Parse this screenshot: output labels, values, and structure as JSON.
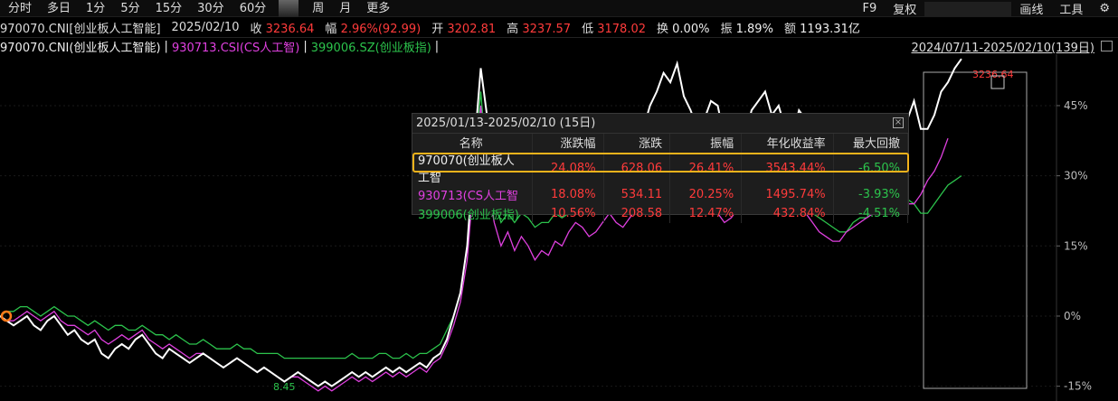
{
  "toolbar": {
    "timeframes": [
      "分时",
      "多日",
      "1分",
      "5分",
      "15分",
      "30分",
      "60分",
      "周",
      "月",
      "更多"
    ],
    "right": [
      "F9",
      "复权",
      "画线",
      "工具"
    ]
  },
  "quote": {
    "code": "970070.CNI[创业板人工智能]",
    "date": "2025/02/10",
    "close_label": "收",
    "close": "3236.64",
    "change_label": "幅",
    "change": "2.96%(92.99)",
    "open_label": "开",
    "open": "3202.81",
    "high_label": "高",
    "high": "3237.57",
    "low_label": "低",
    "low": "3178.02",
    "turnover_label": "换",
    "turnover": "0.00%",
    "amplitude_label": "振",
    "amplitude": "1.89%",
    "amount_label": "额",
    "amount": "1193.31亿"
  },
  "legend": {
    "s1": "970070.CNI(创业板人工智能)",
    "s2": "930713.CSI(CS人工智)",
    "s3": "399006.SZ(创业板指)",
    "sep": "|",
    "range": "2024/07/11-2025/02/10(139日)"
  },
  "panel": {
    "title": "2025/01/13-2025/02/10 (15日)",
    "headers": [
      "名称",
      "涨跌幅",
      "涨跌",
      "振幅",
      "年化收益率",
      "最大回撤"
    ],
    "rows": [
      [
        "970070(创业板人工智",
        "24.08%",
        "628.06",
        "26.41%",
        "3543.44%",
        "-6.50%"
      ],
      [
        "930713(CS人工智",
        "18.08%",
        "534.11",
        "20.25%",
        "1495.74%",
        "-3.93%"
      ],
      [
        "399006(创业板指)",
        "10.56%",
        "208.58",
        "12.47%",
        "432.84%",
        "-4.51%"
      ]
    ]
  },
  "colors": {
    "s1": "#ffffff",
    "s2": "#e040e0",
    "s3": "#2cc34c",
    "up": "#ff3b3b",
    "down": "#2cc34c"
  },
  "chart_data": {
    "type": "line",
    "y_ticks": [
      "45%",
      "30%",
      "15%",
      "0%",
      "-15%"
    ],
    "y_values": [
      45,
      30,
      15,
      0,
      -15
    ],
    "ylim": [
      -17,
      56
    ],
    "x_count": 139,
    "min_label": "8.45",
    "max_label": "3236.64",
    "series": [
      {
        "name": "970070.CNI(创业板人工智能)",
        "values": [
          0,
          -1,
          -2,
          -1,
          0,
          -2,
          -3,
          -1,
          0,
          -2,
          -4,
          -3,
          -5,
          -6,
          -5,
          -8,
          -9,
          -7,
          -6,
          -7,
          -5,
          -4,
          -6,
          -8,
          -9,
          -7,
          -8,
          -9,
          -10,
          -9,
          -8,
          -9,
          -10,
          -11,
          -10,
          -9,
          -10,
          -11,
          -12,
          -11,
          -12,
          -13,
          -14,
          -13,
          -12,
          -13,
          -14,
          -15,
          -14,
          -15,
          -14,
          -13,
          -12,
          -13,
          -12,
          -13,
          -12,
          -11,
          -12,
          -11,
          -12,
          -11,
          -10,
          -11,
          -9,
          -8,
          -5,
          0,
          5,
          15,
          35,
          53,
          42,
          35,
          38,
          32,
          36,
          34,
          31,
          33,
          30,
          29,
          33,
          31,
          32,
          34,
          33,
          30,
          32,
          33,
          35,
          31,
          33,
          36,
          38,
          40,
          45,
          48,
          52,
          50,
          54,
          47,
          44,
          40,
          42,
          46,
          45,
          38,
          35,
          36,
          38,
          44,
          46,
          48,
          43,
          45,
          40,
          38,
          44,
          42,
          38,
          36,
          34,
          31,
          28,
          25,
          25,
          30,
          32,
          34,
          35,
          36,
          37,
          39,
          42,
          46,
          40,
          40,
          43,
          48,
          50,
          53,
          55
        ]
      },
      {
        "name": "930713.CSI(CS人工智)",
        "values": [
          0,
          -1,
          -1,
          0,
          1,
          0,
          -1,
          0,
          1,
          -1,
          -2,
          -2,
          -3,
          -4,
          -3,
          -5,
          -6,
          -5,
          -4,
          -5,
          -4,
          -3,
          -5,
          -6,
          -7,
          -6,
          -7,
          -8,
          -9,
          -8,
          -8,
          -9,
          -10,
          -11,
          -10,
          -9,
          -10,
          -11,
          -12,
          -11,
          -12,
          -13,
          -14,
          -13,
          -13,
          -14,
          -15,
          -16,
          -15,
          -16,
          -15,
          -14,
          -13,
          -14,
          -13,
          -14,
          -13,
          -12,
          -13,
          -12,
          -13,
          -12,
          -11,
          -12,
          -10,
          -9,
          -6,
          -2,
          3,
          12,
          30,
          45,
          28,
          20,
          15,
          18,
          14,
          17,
          15,
          12,
          14,
          13,
          16,
          15,
          18,
          20,
          19,
          17,
          18,
          20,
          22,
          20,
          19,
          21,
          23,
          25,
          28,
          30,
          29,
          31,
          27,
          25,
          22,
          24,
          27,
          26,
          22,
          20,
          21,
          23,
          26,
          27,
          28,
          25,
          26,
          23,
          22,
          25,
          24,
          22,
          20,
          18,
          17,
          16,
          16,
          18,
          19,
          20,
          21,
          22,
          23,
          24,
          25,
          27,
          24,
          24,
          26,
          29,
          31,
          34,
          38
        ]
      },
      {
        "name": "399006.SZ(创业板指)",
        "values": [
          0,
          1,
          1,
          2,
          2,
          1,
          0,
          1,
          2,
          1,
          0,
          0,
          -1,
          -2,
          -1,
          -2,
          -3,
          -2,
          -2,
          -3,
          -3,
          -2,
          -3,
          -4,
          -4,
          -5,
          -4,
          -5,
          -6,
          -6,
          -5,
          -6,
          -7,
          -7,
          -7,
          -6,
          -7,
          -7,
          -8,
          -8,
          -8,
          -8,
          -9,
          -9,
          -9,
          -9,
          -9,
          -9,
          -9,
          -9,
          -9,
          -9,
          -8,
          -9,
          -9,
          -9,
          -8,
          -8,
          -9,
          -9,
          -8,
          -9,
          -8,
          -8,
          -7,
          -6,
          -3,
          0,
          5,
          15,
          32,
          48,
          30,
          25,
          20,
          22,
          20,
          22,
          21,
          19,
          20,
          20,
          22,
          21,
          22,
          24,
          23,
          22,
          23,
          24,
          25,
          24,
          23,
          24,
          25,
          27,
          29,
          30,
          29,
          31,
          28,
          27,
          25,
          26,
          28,
          27,
          24,
          23,
          24,
          25,
          27,
          28,
          28,
          26,
          27,
          25,
          24,
          26,
          25,
          23,
          22,
          21,
          20,
          19,
          18,
          18,
          20,
          21,
          21,
          22,
          22,
          23,
          24,
          24,
          25,
          24,
          22,
          22,
          24,
          26,
          28,
          29,
          30
        ]
      }
    ]
  }
}
